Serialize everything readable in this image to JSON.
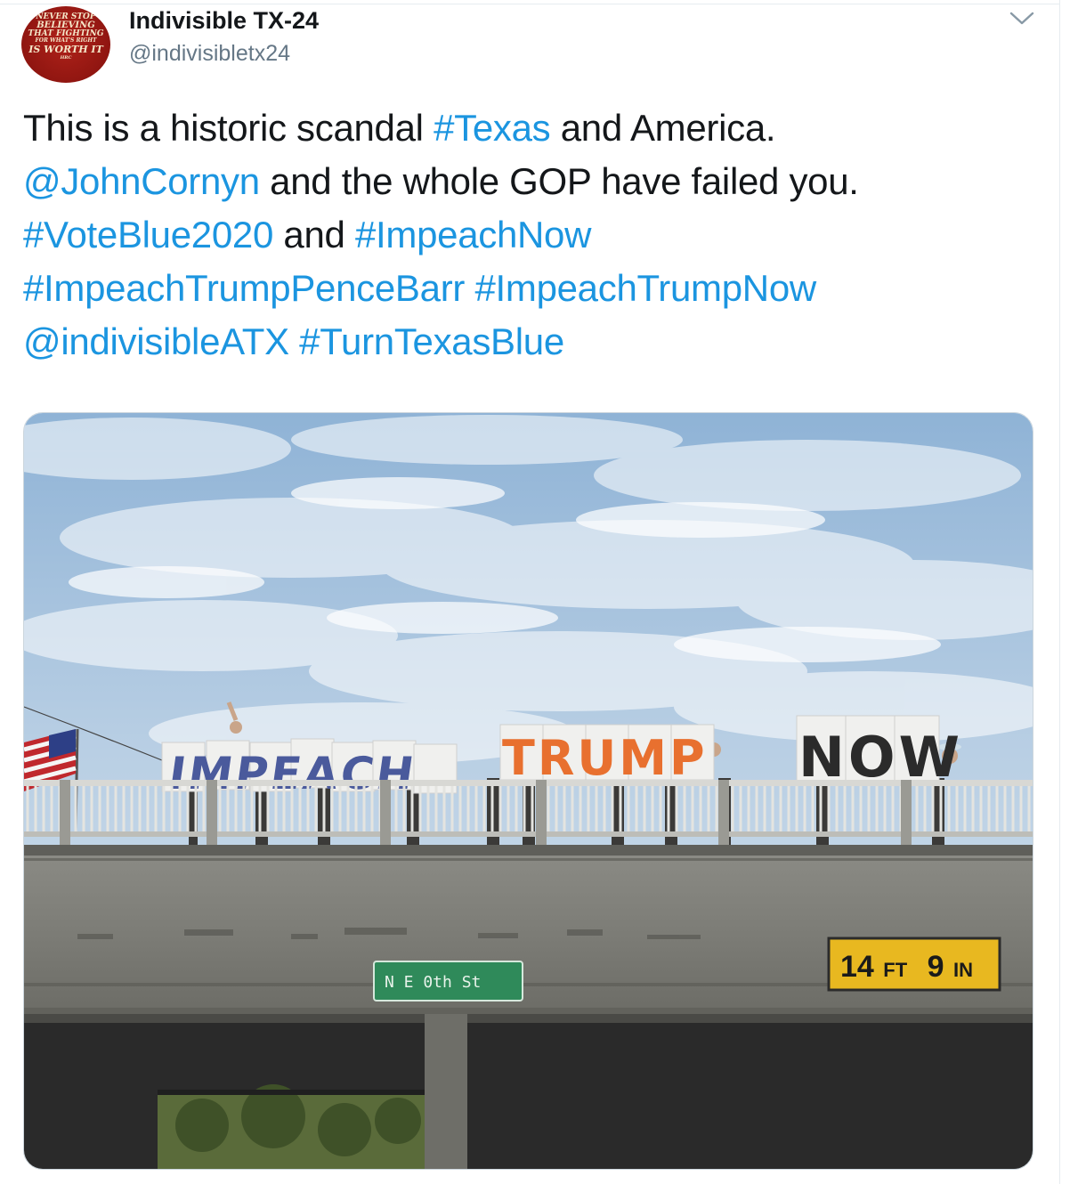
{
  "tweet": {
    "author": {
      "name": "Indivisible TX-24",
      "handle": "@indivisibletx24",
      "avatar_text": [
        "NEVER STOP",
        "BELIEVING",
        "THAT FIGHTING",
        "FOR WHAT'S RIGHT",
        "IS WORTH IT",
        "HRC"
      ]
    },
    "menu_icon": "chevron-down-icon",
    "lines": [
      [
        {
          "type": "text",
          "text": "This is a historic scandal "
        },
        {
          "type": "hashtag",
          "text": "#Texas"
        },
        {
          "type": "text",
          "text": " and America."
        }
      ],
      [
        {
          "type": "mention",
          "text": "@JohnCornyn"
        },
        {
          "type": "text",
          "text": " and the whole GOP have failed you."
        }
      ],
      [
        {
          "type": "hashtag",
          "text": "#VoteBlue2020"
        },
        {
          "type": "text",
          "text": " and "
        },
        {
          "type": "hashtag",
          "text": "#ImpeachNow"
        }
      ],
      [
        {
          "type": "hashtag",
          "text": "#ImpeachTrumpPenceBarr"
        },
        {
          "type": "text",
          "text": " "
        },
        {
          "type": "hashtag",
          "text": "#ImpeachTrumpNow"
        }
      ],
      [
        {
          "type": "mention",
          "text": "@indivisibleATX"
        },
        {
          "type": "text",
          "text": " "
        },
        {
          "type": "hashtag",
          "text": "#TurnTexasBlue"
        }
      ]
    ],
    "link_color": "#1b95e0",
    "photo": {
      "sign_words": [
        "IMPEACH",
        "TRUMP",
        "NOW"
      ],
      "street_sign": "N E 0th St",
      "clearance_sign": {
        "big1": "14",
        "small1": "FT",
        "big2": "9",
        "small2": "IN"
      }
    }
  }
}
